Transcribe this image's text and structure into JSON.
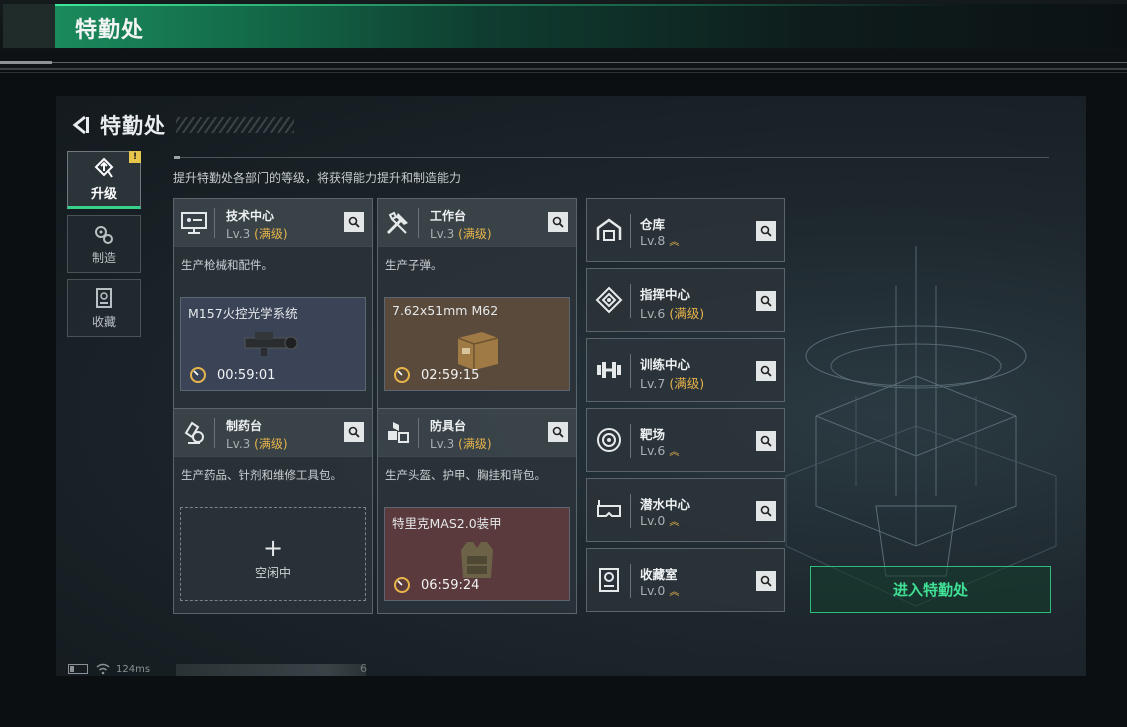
{
  "window": {
    "title": "特勤处"
  },
  "screen": {
    "title": "特勤处",
    "description": "提升特勤处各部门的等级，将获得能力提升和制造能力",
    "nav": [
      {
        "label": "升级",
        "icon": "upgrade-icon",
        "active": true,
        "badge": "!"
      },
      {
        "label": "制造",
        "icon": "gears-icon",
        "active": false
      },
      {
        "label": "收藏",
        "icon": "collection-icon",
        "active": false
      }
    ],
    "workshops": [
      {
        "name": "技术中心",
        "level": "Lv.3",
        "maxed": "(满级)",
        "icon": "tech-center-icon",
        "text": "生产枪械和配件。",
        "job": {
          "name": "M157火控光学系统",
          "timer": "00:59:01",
          "style": "blue"
        }
      },
      {
        "name": "工作台",
        "level": "Lv.3",
        "maxed": "(满级)",
        "icon": "workbench-icon",
        "text": "生产子弹。",
        "job": {
          "name": "7.62x51mm M62",
          "timer": "02:59:15",
          "style": "brown"
        }
      },
      {
        "name": "制药台",
        "level": "Lv.3",
        "maxed": "(满级)",
        "icon": "pharmacy-icon",
        "text": "生产药品、针剂和维修工具包。",
        "job": {
          "idle_label": "空闲中",
          "plus": "+",
          "style": "idle"
        }
      },
      {
        "name": "防具台",
        "level": "Lv.3",
        "maxed": "(满级)",
        "icon": "armor-bench-icon",
        "text": "生产头盔、护甲、胸挂和背包。",
        "job": {
          "name": "特里克MAS2.0装甲",
          "timer": "06:59:24",
          "style": "red"
        }
      }
    ],
    "facilities": [
      {
        "name": "仓库",
        "level": "Lv.8",
        "maxed": "",
        "upgradable": true,
        "icon": "warehouse-icon"
      },
      {
        "name": "指挥中心",
        "level": "Lv.6",
        "maxed": "(满级)",
        "upgradable": false,
        "icon": "command-center-icon"
      },
      {
        "name": "训练中心",
        "level": "Lv.7",
        "maxed": "(满级)",
        "upgradable": false,
        "icon": "dumbbell-icon"
      },
      {
        "name": "靶场",
        "level": "Lv.6",
        "maxed": "",
        "upgradable": true,
        "icon": "target-icon"
      },
      {
        "name": "潜水中心",
        "level": "Lv.0",
        "maxed": "",
        "upgradable": true,
        "icon": "diving-mask-icon"
      },
      {
        "name": "收藏室",
        "level": "Lv.0",
        "maxed": "",
        "upgradable": true,
        "icon": "collection-room-icon"
      }
    ],
    "enter_button": "进入特勤处",
    "status": {
      "ping": "124ms",
      "number": "6"
    }
  },
  "colors": {
    "accent": "#36d28a",
    "maxed": "#e8b54a",
    "title_band": "#1b8a5c"
  }
}
